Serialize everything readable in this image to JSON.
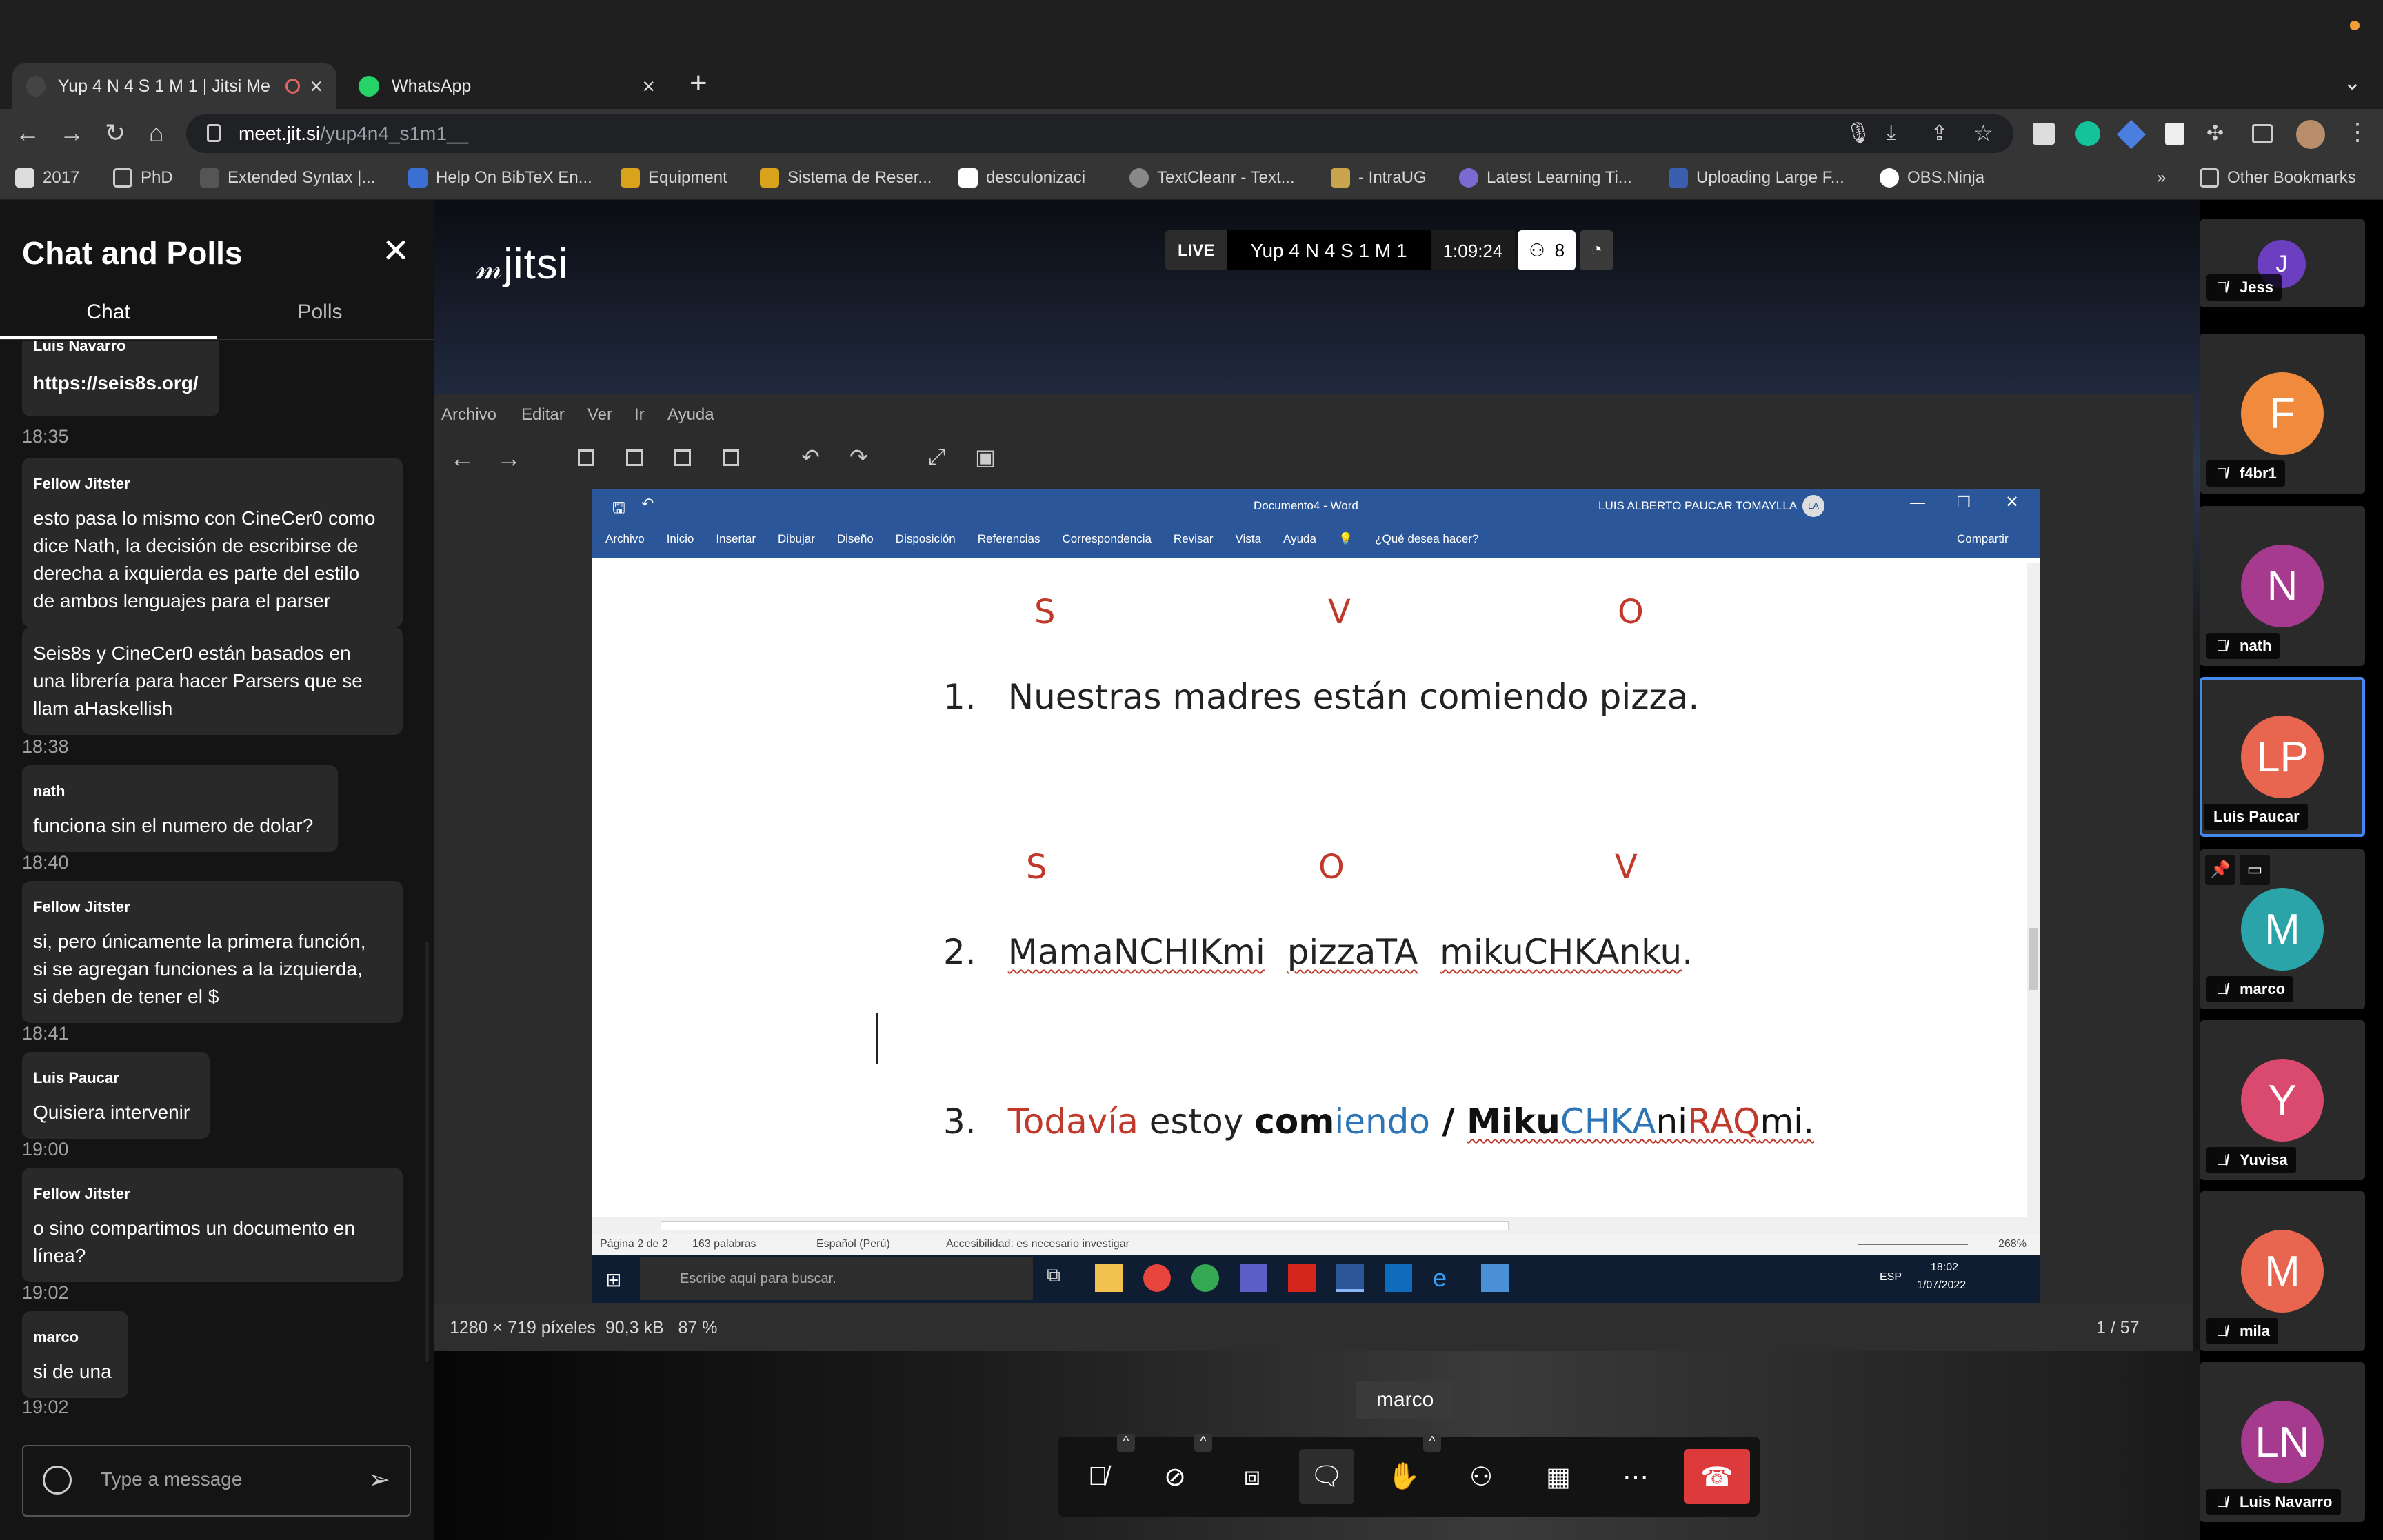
{
  "browser": {
    "tabs": [
      {
        "title": "Yup 4 N 4 S 1 M 1 | Jitsi Me",
        "active": true
      },
      {
        "title": "WhatsApp",
        "active": false
      }
    ],
    "url_host": "meet.jit.si",
    "url_path": "/yup4n4_s1m1__",
    "bookmarks": [
      "2017",
      "PhD",
      "Extended Syntax |...",
      "Help On BibTeX En...",
      "Equipment",
      "Sistema de Reser...",
      "desculonizaci",
      "TextCleanr - Text...",
      "- IntraUG",
      "Latest Learning Ti...",
      "Uploading Large F...",
      "OBS.Ninja"
    ],
    "bookmarks_overflow": "»",
    "other_bookmarks": "Other Bookmarks"
  },
  "chat": {
    "title": "Chat and Polls",
    "tabs": [
      "Chat",
      "Polls"
    ],
    "partial_sender": "Luis Navarro",
    "messages": [
      {
        "sender": "",
        "text": [
          "https://seis8s.org/"
        ],
        "time": "18:35"
      },
      {
        "sender": "Fellow Jitster",
        "text": [
          "esto pasa lo mismo con CineCer0 como",
          "dice Nath, la decisión de escribirse de",
          "derecha a ixquierda es parte del estilo",
          "de ambos lenguajes para el parser"
        ],
        "time": ""
      },
      {
        "sender": "",
        "text": [
          "Seis8s y CineCer0 están basados en",
          "una librería para hacer Parsers que se",
          "llam aHaskellish"
        ],
        "time": "18:38"
      },
      {
        "sender": "nath",
        "text": [
          "funciona sin el numero de dolar?"
        ],
        "time": "18:40"
      },
      {
        "sender": "Fellow Jitster",
        "text": [
          "si, pero únicamente la primera función,",
          "si se agregan funciones a la izquierda,",
          "si deben de tener el $"
        ],
        "time": "18:41"
      },
      {
        "sender": "Luis Paucar",
        "text": [
          "Quisiera intervenir"
        ],
        "time": "19:00"
      },
      {
        "sender": "Fellow Jitster",
        "text": [
          "o sino compartimos un documento en",
          "línea?"
        ],
        "time": "19:02"
      },
      {
        "sender": "marco",
        "text": [
          "si de una"
        ],
        "time": "19:02"
      }
    ],
    "input_placeholder": "Type a message"
  },
  "meeting": {
    "logo": "jitsi",
    "live_label": "LIVE",
    "room_name": "Yup 4 N 4 S 1 M 1",
    "duration": "1:09:24",
    "participant_count": "8",
    "dominant_speaker_label": "marco"
  },
  "viewer": {
    "menu": [
      "Archivo",
      "Editar",
      "Ver",
      "Ir",
      "Ayuda"
    ],
    "info": "1280 × 719 píxeles  90,3 kB   87 %",
    "page": "1 / 57"
  },
  "word": {
    "title": "Documento4 - Word",
    "user": "LUIS ALBERTO PAUCAR TOMAYLLA",
    "user_initials": "LA",
    "ribbon": [
      "Archivo",
      "Inicio",
      "Insertar",
      "Dibujar",
      "Diseño",
      "Disposición",
      "Referencias",
      "Correspondencia",
      "Revisar",
      "Vista",
      "Ayuda"
    ],
    "tell_me": "¿Qué desea hacer?",
    "share": "Compartir",
    "row1_labels": [
      "S",
      "V",
      "O"
    ],
    "line1_num": "1.",
    "line1": "Nuestras madres están comiendo pizza.",
    "row2_labels": [
      "S",
      "O",
      "V"
    ],
    "line2_num": "2.",
    "line2": [
      "MamaNCHIKmi",
      "pizzaTA",
      "mikuCHKAnku",
      "."
    ],
    "line3_num": "3.",
    "line3": [
      {
        "t": "Todavía",
        "c": "#c0392b",
        "b": false
      },
      {
        "t": " estoy ",
        "c": "#222",
        "b": false
      },
      {
        "t": "com",
        "c": "#111",
        "b": true
      },
      {
        "t": "iendo",
        "c": "#2e75b6",
        "b": false
      },
      {
        "t": " / ",
        "c": "#111",
        "b": true
      },
      {
        "t": "Miku",
        "c": "#111",
        "b": true
      },
      {
        "t": "CHKA",
        "c": "#2e75b6",
        "b": false
      },
      {
        "t": "ni",
        "c": "#111",
        "b": false
      },
      {
        "t": "RAQ",
        "c": "#c0392b",
        "b": false
      },
      {
        "t": "mi",
        "c": "#111",
        "b": false
      },
      {
        "t": ".",
        "c": "#111",
        "b": false
      }
    ],
    "status": {
      "page": "Página 2 de 2",
      "words": "163 palabras",
      "lang": "Español (Perú)",
      "access": "Accesibilidad: es necesario investigar",
      "zoom": "268%"
    },
    "taskbar": {
      "search": "Escribe aquí para buscar.",
      "lang": "ESP",
      "time": "18:02",
      "date": "1/07/2022"
    }
  },
  "participants": [
    {
      "name": "Jess",
      "initials": "J",
      "color": "#6b3fc0"
    },
    {
      "name": "f4br1",
      "initials": "F",
      "color": "#f08a3c"
    },
    {
      "name": "nath",
      "initials": "N",
      "color": "#a63a8e"
    },
    {
      "name": "Luis Paucar",
      "initials": "LP",
      "color": "#e8664f"
    },
    {
      "name": "marco",
      "initials": "M",
      "color": "#2aa4a8"
    },
    {
      "name": "Yuvisa",
      "initials": "Y",
      "color": "#d94a6e"
    },
    {
      "name": "mila",
      "initials": "M",
      "color": "#e8664f"
    },
    {
      "name": "Luis Navarro",
      "initials": "LN",
      "color": "#a63a8e"
    }
  ],
  "colors": {
    "accent_blue": "#4687ed",
    "hangup_red": "#dd3b3b",
    "word_blue": "#2b579a",
    "label_red": "#c0392b"
  }
}
